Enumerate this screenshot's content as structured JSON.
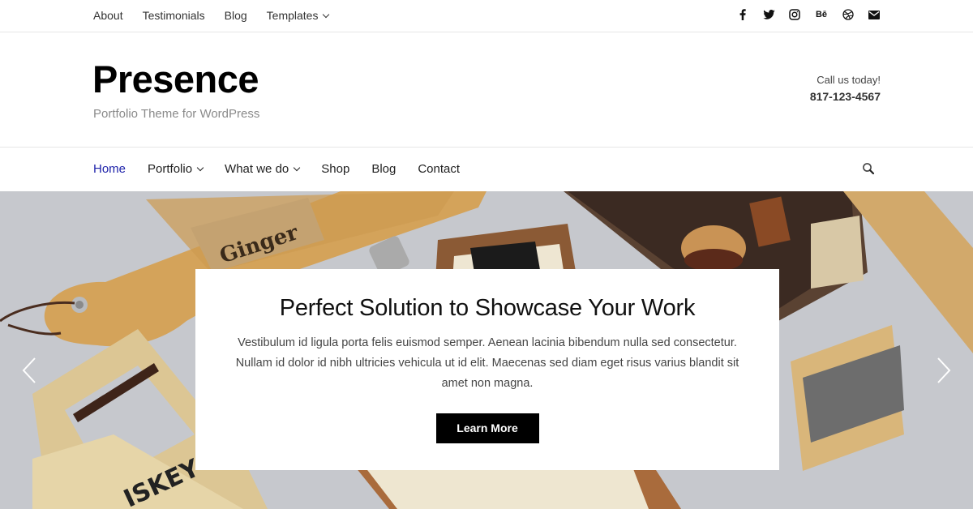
{
  "top_nav": {
    "items": [
      {
        "label": "About"
      },
      {
        "label": "Testimonials"
      },
      {
        "label": "Blog"
      },
      {
        "label": "Templates",
        "has_dropdown": true
      }
    ]
  },
  "social": {
    "icons": [
      "facebook-icon",
      "twitter-icon",
      "instagram-icon",
      "behance-icon",
      "dribbble-icon",
      "email-icon"
    ],
    "behance_text": "Bē"
  },
  "header": {
    "title": "Presence",
    "tagline": "Portfolio Theme for WordPress",
    "call_label": "Call us today!",
    "phone": "817-123-4567"
  },
  "main_nav": {
    "items": [
      {
        "label": "Home",
        "active": true
      },
      {
        "label": "Portfolio",
        "has_dropdown": true
      },
      {
        "label": "What we do",
        "has_dropdown": true
      },
      {
        "label": "Shop"
      },
      {
        "label": "Blog"
      },
      {
        "label": "Contact"
      }
    ],
    "search_icon": "search-icon"
  },
  "hero": {
    "heading": "Perfect Solution to Showcase Your Work",
    "body": "Vestibulum id ligula porta felis euismod semper. Aenean lacinia bibendum nulla sed consectetur. Nullam id dolor id nibh ultricies vehicula ut id elit. Maecenas sed diam eget risus varius blandit sit amet non magna.",
    "button_label": "Learn More",
    "prev_icon": "chevron-left-icon",
    "next_icon": "chevron-right-icon"
  },
  "colors": {
    "accent": "#1e22aa",
    "button_bg": "#000000",
    "tagline": "#8a8a8a",
    "hero_bg": "#c7c9ce"
  }
}
